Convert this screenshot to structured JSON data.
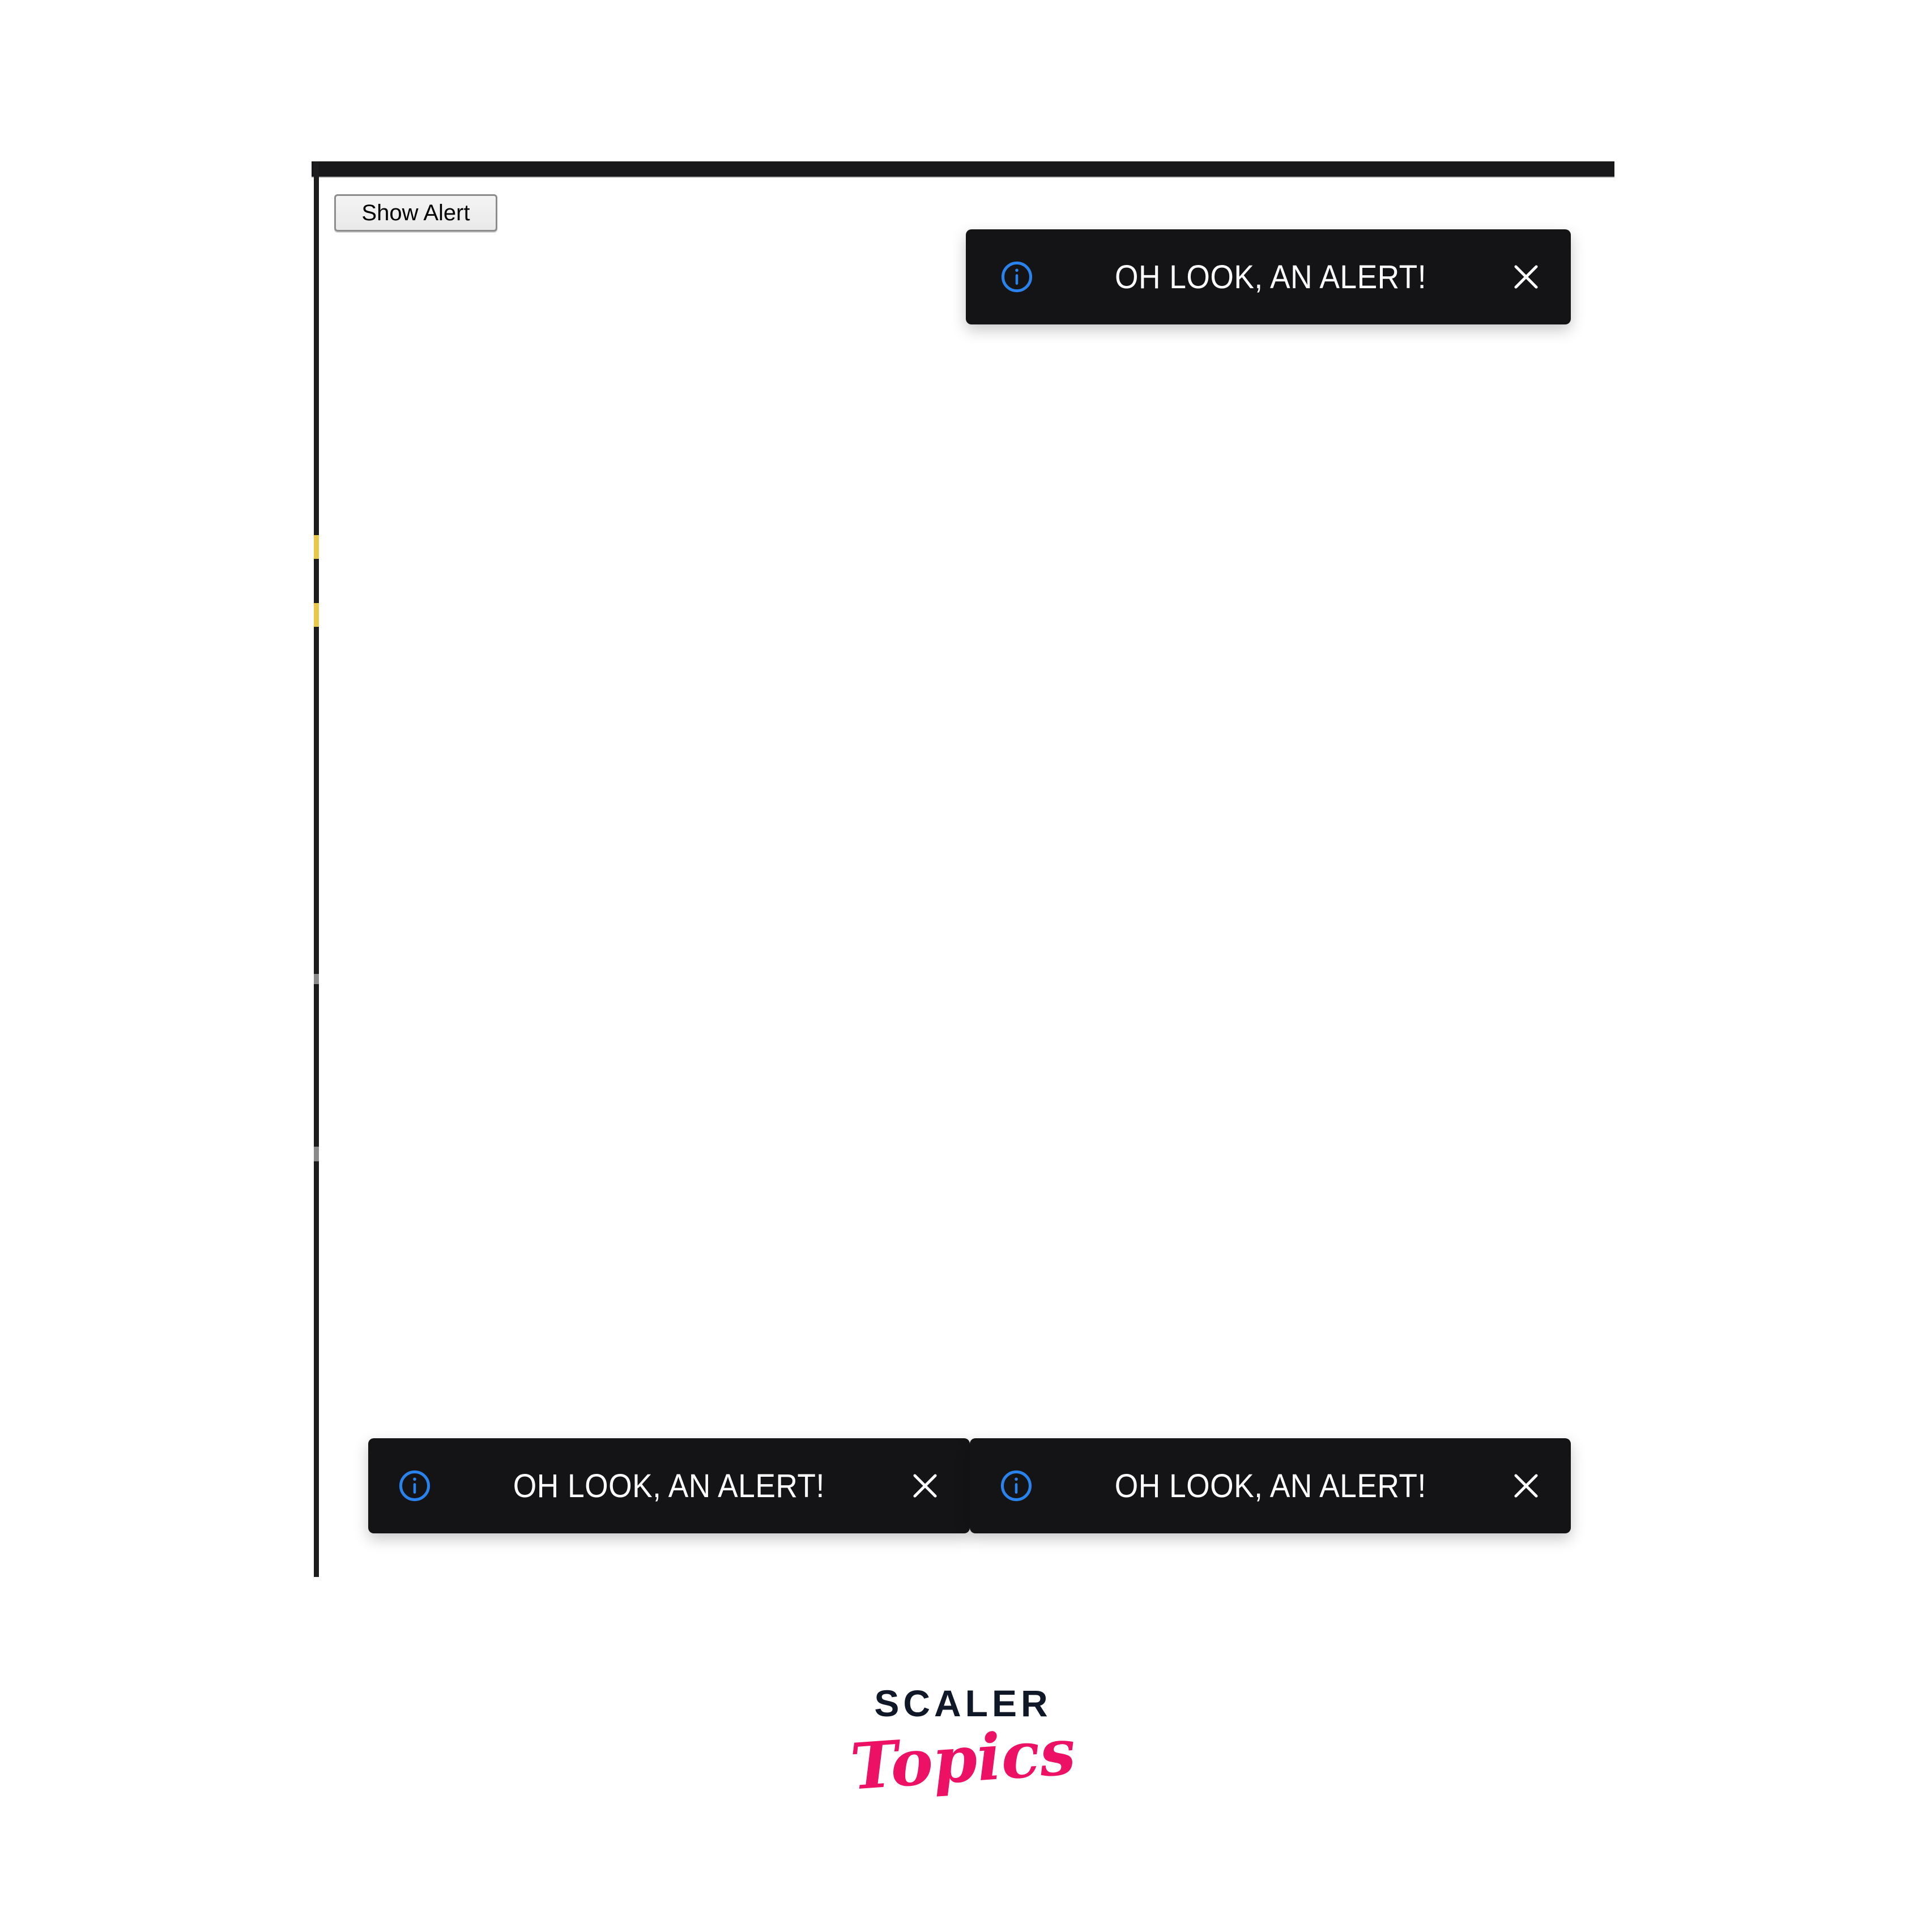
{
  "page": {
    "background_color": "#ffffff",
    "frame_border_color": "#1c1c1e"
  },
  "toolbar": {
    "show_alert_label": "Show Alert"
  },
  "toasts": {
    "accent_color": "#2a82ec",
    "background_color": "#141417",
    "text_color": "#ffffff",
    "icon_name": "info-circle-icon",
    "close_icon_name": "close-icon",
    "items": [
      {
        "position": "top-right",
        "message": "OH LOOK, AN ALERT!",
        "close_label": "✕"
      },
      {
        "position": "bottom-left",
        "message": "OH LOOK, AN ALERT!",
        "close_label": "✕"
      },
      {
        "position": "bottom-right",
        "message": "OH LOOK, AN ALERT!",
        "close_label": "✕"
      }
    ]
  },
  "brand": {
    "name_primary": "SCALER",
    "name_secondary": "Topics",
    "primary_color": "#101828",
    "secondary_color": "#ec1164"
  }
}
